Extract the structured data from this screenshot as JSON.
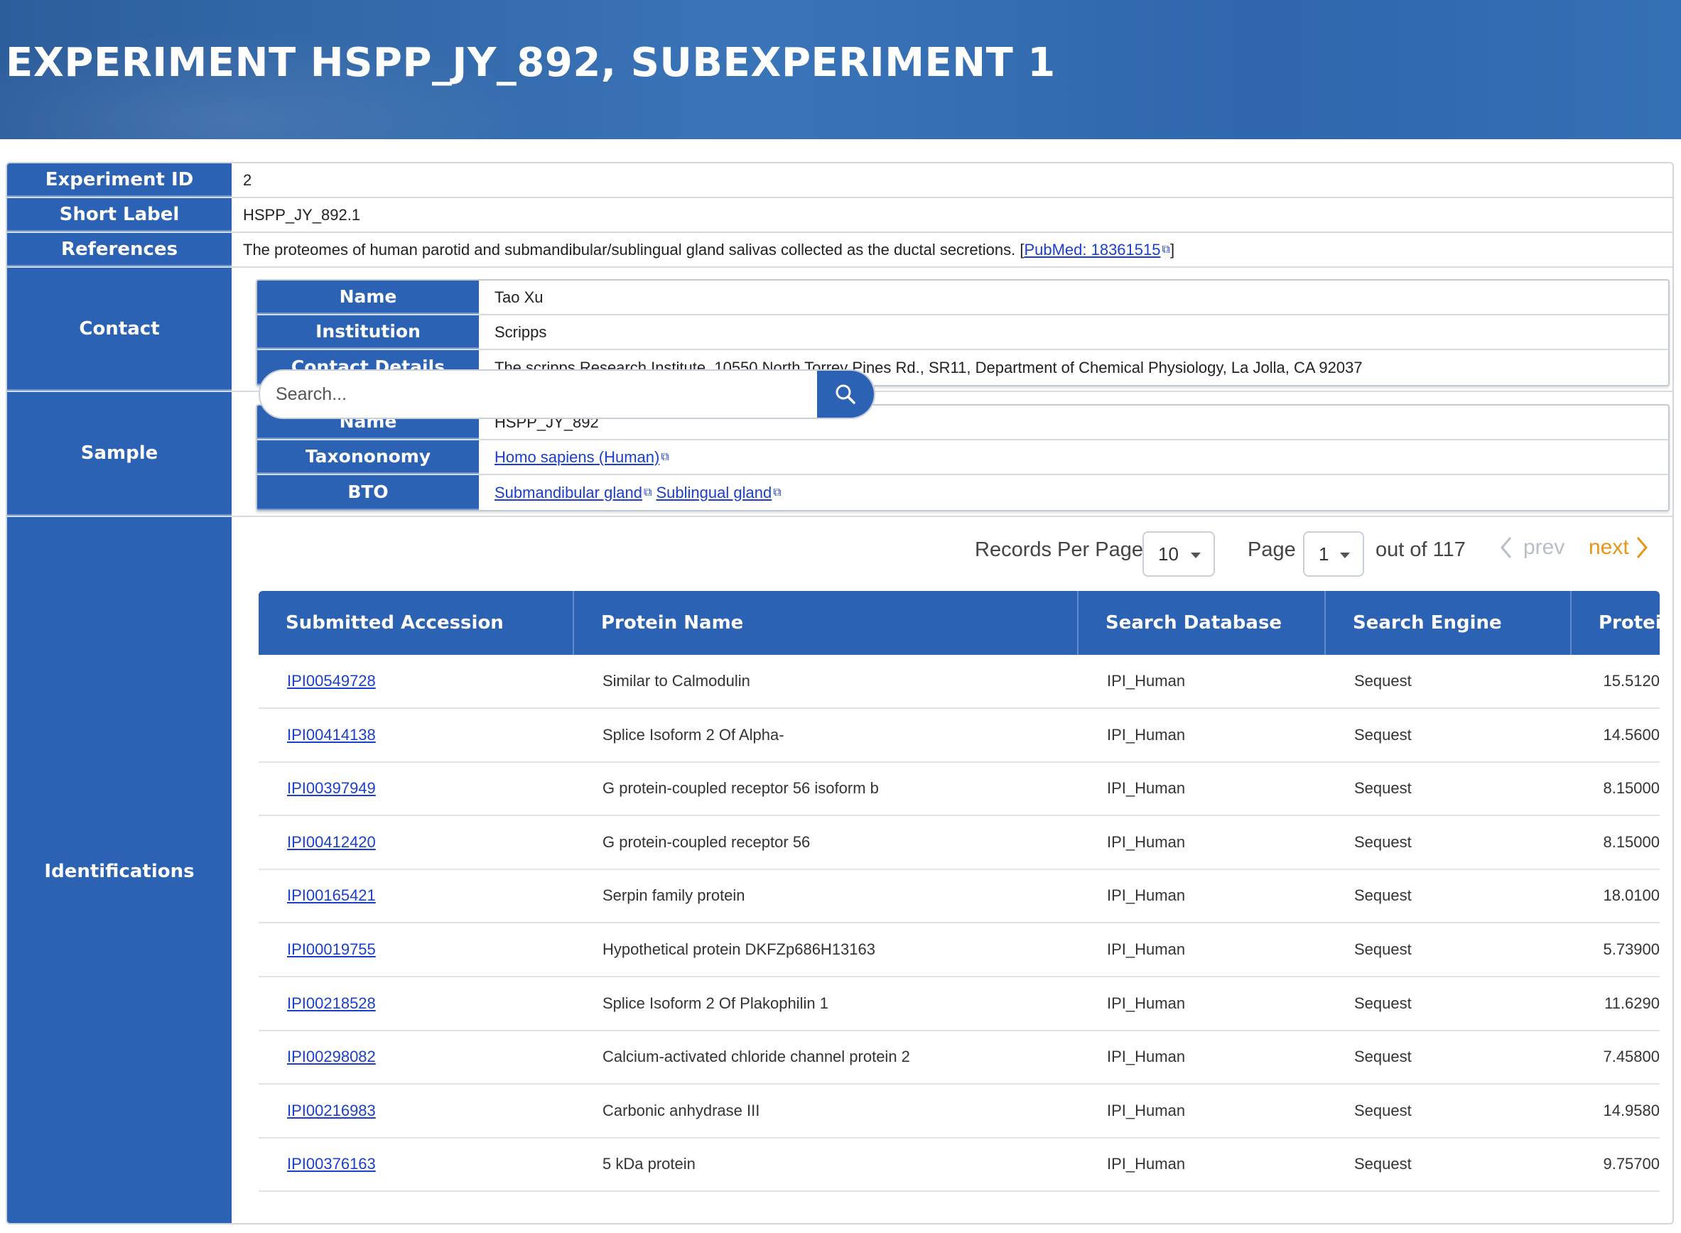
{
  "header": {
    "title": "EXPERIMENT HSPP_JY_892, SUBEXPERIMENT 1"
  },
  "details": {
    "experiment_id": {
      "label": "Experiment ID",
      "value": "2"
    },
    "short_label": {
      "label": "Short Label",
      "value": "HSPP_JY_892.1"
    },
    "references": {
      "label": "References",
      "text": "The proteomes of human parotid and submandibular/sublingual gland salivas collected as the ductal secretions. [",
      "link": "PubMed: 18361515",
      "suffix": "]"
    }
  },
  "contact": {
    "label": "Contact",
    "name_label": "Name",
    "name": "Tao Xu",
    "institution_label": "Institution",
    "institution": "Scripps",
    "details_label": "Contact Details",
    "details": "The scripps Research Institute, 10550 North Torrey Pines Rd., SR11, Department of Chemical Physiology, La Jolla, CA 92037"
  },
  "sample": {
    "label": "Sample",
    "name_label": "Name",
    "name": "HSPP_JY_892",
    "taxonomy_label": "Taxononomy",
    "taxonomy": "Homo sapiens (Human)",
    "bto_label": "BTO",
    "bto": [
      "Submandibular gland",
      "Sublingual gland"
    ]
  },
  "identifications": {
    "label": "Identifications",
    "search_placeholder": "Search...",
    "records_per_page_label": "Records Per Page",
    "records_per_page": "10",
    "page_label": "Page",
    "page": "1",
    "out_of": "out of 117",
    "prev": "prev",
    "next": "next",
    "columns": [
      "Submitted Accession",
      "Protein Name",
      "Search Database",
      "Search Engine",
      "Protei"
    ],
    "rows": [
      {
        "accession": "IPI00549728",
        "protein": "Similar to Calmodulin",
        "database": "IPI_Human",
        "engine": "Sequest",
        "score": "15.5120"
      },
      {
        "accession": "IPI00414138",
        "protein": "Splice Isoform 2 Of Alpha-",
        "database": "IPI_Human",
        "engine": "Sequest",
        "score": "14.5600"
      },
      {
        "accession": "IPI00397949",
        "protein": "G protein-coupled receptor 56 isoform b",
        "database": "IPI_Human",
        "engine": "Sequest",
        "score": "8.15000"
      },
      {
        "accession": "IPI00412420",
        "protein": "G protein-coupled receptor 56",
        "database": "IPI_Human",
        "engine": "Sequest",
        "score": "8.15000"
      },
      {
        "accession": "IPI00165421",
        "protein": "Serpin family protein",
        "database": "IPI_Human",
        "engine": "Sequest",
        "score": "18.0100"
      },
      {
        "accession": "IPI00019755",
        "protein": "Hypothetical protein DKFZp686H13163",
        "database": "IPI_Human",
        "engine": "Sequest",
        "score": "5.73900"
      },
      {
        "accession": "IPI00218528",
        "protein": "Splice Isoform 2 Of Plakophilin 1",
        "database": "IPI_Human",
        "engine": "Sequest",
        "score": "11.6290"
      },
      {
        "accession": "IPI00298082",
        "protein": "Calcium-activated chloride channel protein 2",
        "database": "IPI_Human",
        "engine": "Sequest",
        "score": "7.45800"
      },
      {
        "accession": "IPI00216983",
        "protein": "Carbonic anhydrase III",
        "database": "IPI_Human",
        "engine": "Sequest",
        "score": "14.9580"
      },
      {
        "accession": "IPI00376163",
        "protein": "5 kDa protein",
        "database": "IPI_Human",
        "engine": "Sequest",
        "score": "9.75700"
      }
    ]
  },
  "colors": {
    "primary": "#2b62b3",
    "link": "#1a3fcf",
    "next": "#e8961a",
    "prev_disabled": "#b9bec6"
  },
  "icons": {
    "search": "search-icon",
    "external": "external-link-icon",
    "dropdown": "chevron-down-icon",
    "prev": "chevron-left-icon",
    "next": "chevron-right-icon"
  }
}
